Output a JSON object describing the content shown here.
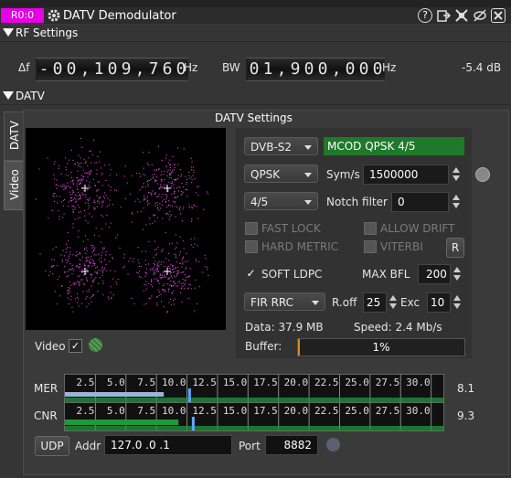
{
  "titlebar": {
    "badge": "R0:0",
    "title": "DATV Demodulator"
  },
  "rf": {
    "header": "RF Settings",
    "df_label": "Δf",
    "df_digits": [
      "-",
      "0",
      "0",
      ",",
      "1",
      "0",
      "9",
      ",",
      "7",
      "6",
      "0"
    ],
    "df_unit": "Hz",
    "bw_label": "BW",
    "bw_digits": [
      "0",
      "1",
      ",",
      "9",
      "0",
      "0",
      ",",
      "0",
      "0",
      "0"
    ],
    "bw_unit": "Hz",
    "power": "-5.4 dB"
  },
  "datv": {
    "header": "DATV",
    "tabs": [
      "DATV",
      "Video"
    ],
    "settings_title": "DATV Settings",
    "standard": "DVB-S2",
    "modcod": "MCOD QPSK 4/5",
    "modulation": "QPSK",
    "symrate_label": "Sym/s",
    "symrate": "1500000",
    "fec": "4/5",
    "notch_label": "Notch filter",
    "notch": "0",
    "fast_lock": "FAST LOCK",
    "allow_drift": "ALLOW DRIFT",
    "hard_metric": "HARD METRIC",
    "viterbi": "VITERBI",
    "r_button": "R",
    "soft_ldpc": "SOFT LDPC",
    "soft_ldpc_checked": "✓",
    "maxbfl_label": "MAX BFL",
    "maxbfl": "200",
    "filter": "FIR RRC",
    "roff_label": "R.off",
    "roff": "25",
    "exc_label": "Exc",
    "exc": "10",
    "data_label": "Data: 37.9 MB",
    "speed_label": "Speed: 2.4 Mb/s",
    "buffer_label": "Buffer:",
    "buffer_value": "1%",
    "buffer_fraction": 0.01,
    "video_label": "Video",
    "video_checked": "✓"
  },
  "meters": {
    "ticks": [
      "2.5",
      "5.0",
      "7.5",
      "10.0",
      "12.5",
      "15.0",
      "17.5",
      "20.0",
      "22.5",
      "25.0",
      "27.5",
      "30.0"
    ],
    "mer": {
      "label": "MER",
      "value": "8.1",
      "level": 8.1,
      "avg": 10.1
    },
    "cnr": {
      "label": "CNR",
      "value": "9.3",
      "level": 9.3,
      "avg": 10.4
    }
  },
  "udp": {
    "button": "UDP",
    "addr_label": "Addr",
    "addr": "127.0 .0 .1",
    "port_label": "Port",
    "port": "8882"
  },
  "colors": {
    "badge": "#e600e6",
    "modcod_bg": "#1e7a2a",
    "constellation": "#ff55ff",
    "meter_green": "#1e9a3a",
    "meter_blue": "#9ab4d8"
  }
}
